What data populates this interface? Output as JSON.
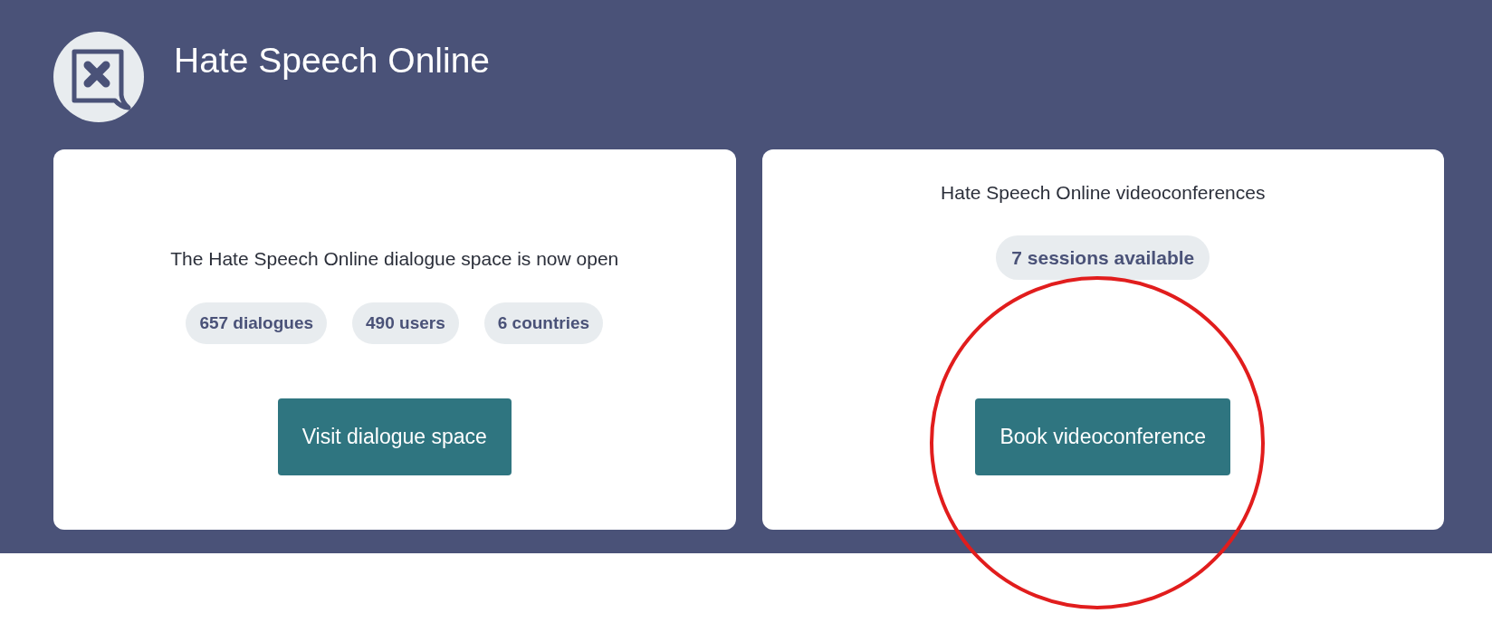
{
  "header": {
    "title": "Hate Speech Online"
  },
  "cards": [
    {
      "kind": "stats",
      "text": "The Hate Speech Online dialogue space is now open",
      "badges": [
        "657 dialogues",
        "490 users",
        "6 countries"
      ],
      "button": {
        "label": "Visit dialogue space",
        "highlighted": false
      }
    },
    {
      "kind": "sessions",
      "text": "Hate Speech Online videoconferences",
      "badges": [
        "7 sessions available"
      ],
      "button": {
        "label": "Book videoconference",
        "highlighted": true
      }
    }
  ]
}
